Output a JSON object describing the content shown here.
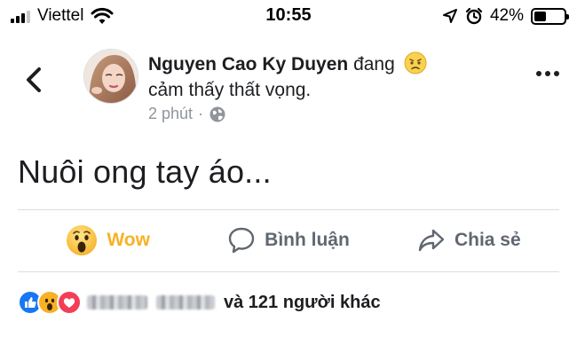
{
  "status_bar": {
    "carrier": "Viettel",
    "time": "10:55",
    "battery_percent": "42%",
    "battery_level": 0.42,
    "icons": [
      "signal-icon",
      "wifi-icon",
      "location-arrow-icon",
      "alarm-icon",
      "battery-icon"
    ]
  },
  "post": {
    "author_name": "Nguyen Cao Ky Duyen",
    "feeling_verb": "đang",
    "feeling_text": "cảm thấy thất vọng.",
    "feeling_emoji": "disappointed-face-icon",
    "time_ago": "2 phút",
    "separator": "·",
    "privacy_icon": "globe-icon",
    "text": "Nuôi ong tay áo..."
  },
  "actions": {
    "wow_label": "Wow",
    "comment_label": "Bình luận",
    "share_label": "Chia sẻ"
  },
  "reactions": {
    "icons": [
      "like-icon",
      "wow-icon",
      "love-icon"
    ],
    "others_text": "và 121 người khác"
  },
  "colors": {
    "wow": "#f7b125",
    "action_gray": "#606770",
    "like_blue": "#1877f2",
    "love_red": "#f33e58",
    "meta_gray": "#90949c"
  }
}
